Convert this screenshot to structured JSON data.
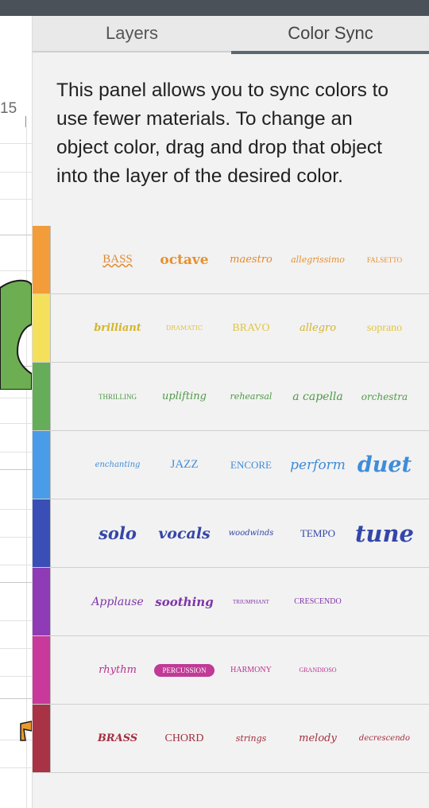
{
  "tabs": {
    "layers": "Layers",
    "color_sync": "Color Sync"
  },
  "ruler": {
    "number": "15"
  },
  "description": "This panel allows you to sync colors to use fewer materials. To change an object color, drag and drop that object into the layer of the desired color.",
  "rows": [
    {
      "color": "#f39c3a",
      "items": [
        "BASS",
        "octave",
        "maestro",
        "allegrissimo",
        "FALSETTO"
      ]
    },
    {
      "color": "#f5e05c",
      "items": [
        "brilliant",
        "DRAMATIC",
        "BRAVO",
        "allegro",
        "soprano"
      ]
    },
    {
      "color": "#66ad5a",
      "items": [
        "THRILLING",
        "uplifting",
        "rehearsal",
        "a capella",
        "orchestra"
      ]
    },
    {
      "color": "#4a9be8",
      "items": [
        "enchanting",
        "JAZZ",
        "ENCORE",
        "perform",
        "duet"
      ]
    },
    {
      "color": "#3a4fb5",
      "items": [
        "solo",
        "vocals",
        "woodwinds",
        "TEMPO",
        "tune"
      ]
    },
    {
      "color": "#8e3bb5",
      "items": [
        "Applause",
        "soothing",
        "TRIUMPHANT",
        "CRESCENDO"
      ]
    },
    {
      "color": "#c8399b",
      "items": [
        "rhythm",
        "PERCUSSION",
        "HARMONY",
        "GRANDIOSO"
      ]
    },
    {
      "color": "#a83344",
      "items": [
        "BRASS",
        "CHORD",
        "strings",
        "melody",
        "decrescendo"
      ]
    }
  ]
}
